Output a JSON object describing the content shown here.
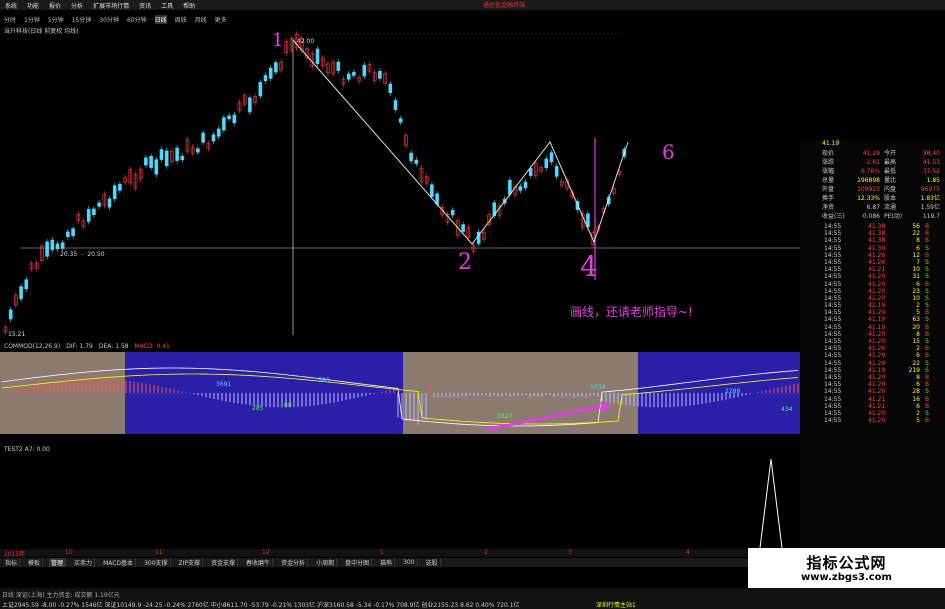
{
  "menubar": {
    "items": [
      "系统",
      "功能",
      "报价",
      "分析",
      "扩展市场行情",
      "资讯",
      "工具",
      "帮助"
    ],
    "title": "通达信金融终端"
  },
  "periodbar": {
    "items": [
      "分时",
      "1分钟",
      "5分钟",
      "15分钟",
      "30分钟",
      "60分钟",
      "日线",
      "周线",
      "月线",
      "更多"
    ],
    "active_index": 6
  },
  "stock": {
    "name": "当升科技(日线 前复权 均线)",
    "price_high": "42.00",
    "price_mid": "20.35",
    "price_mid2": "20.50",
    "price_low": "15.21"
  },
  "annotations": {
    "n1": "1",
    "n2": "2",
    "n4": "4",
    "n6": "6",
    "note": "画线，还请老师指导~!"
  },
  "macd": {
    "title": "COMMOD(12,26,9)",
    "dif": "DIF: 1.79",
    "dea": "DEA: 1.58",
    "macd": "MACD: 0.41",
    "labels": [
      "3691",
      "583",
      "285",
      "88",
      "3820",
      "1034",
      "2288",
      "434"
    ]
  },
  "test": {
    "title": "TEST2 A7: 0.00"
  },
  "right_panel": {
    "code_price": "41.19",
    "rows": [
      {
        "k": "现价",
        "v": "41.29",
        "k2": "今开",
        "v2": "38.40",
        "c": "#f44"
      },
      {
        "k": "涨跌",
        "v": "2.61",
        "k2": "最高",
        "v2": "41.53",
        "c": "#f44"
      },
      {
        "k": "涨幅",
        "v": "6.76%",
        "k2": "最低",
        "v2": "37.52",
        "c": "#f44"
      },
      {
        "k": "总量",
        "v": "196898",
        "k2": "量比",
        "v2": "1.85",
        "c": "#ff0"
      },
      {
        "k": "外盘",
        "v": "109923",
        "k2": "内盘",
        "v2": "86975",
        "c": "#f44"
      },
      {
        "k": "换手",
        "v": "12.33%",
        "k2": "股本",
        "v2": "1.83亿",
        "c": "#ff0"
      },
      {
        "k": "净资",
        "v": "6.87",
        "k2": "流通",
        "v2": "1.59亿",
        "c": "#ccc"
      },
      {
        "k": "收益(三)",
        "v": "0.086",
        "k2": "PE(动)",
        "v2": "119.7",
        "c": "#ccc"
      }
    ],
    "ticks": [
      {
        "t": "14:55",
        "p": "41.38",
        "v": "56",
        "s": "B"
      },
      {
        "t": "14:55",
        "p": "41.38",
        "v": "22",
        "s": "B"
      },
      {
        "t": "14:55",
        "p": "41.38",
        "v": "8",
        "s": "B"
      },
      {
        "t": "14:55",
        "p": "41.30",
        "v": "6",
        "s": "S"
      },
      {
        "t": "14:55",
        "p": "41.26",
        "v": "12",
        "s": "B"
      },
      {
        "t": "14:55",
        "p": "41.26",
        "v": "7",
        "s": "S"
      },
      {
        "t": "14:55",
        "p": "41.21",
        "v": "10",
        "s": "S"
      },
      {
        "t": "14:55",
        "p": "41.20",
        "v": "31",
        "s": "S"
      },
      {
        "t": "14:55",
        "p": "41.20",
        "v": "6",
        "s": "B"
      },
      {
        "t": "14:55",
        "p": "41.20",
        "v": "23",
        "s": "S"
      },
      {
        "t": "14:55",
        "p": "41.20",
        "v": "10",
        "s": "S"
      },
      {
        "t": "14:55",
        "p": "41.19",
        "v": "2",
        "s": "S"
      },
      {
        "t": "14:55",
        "p": "41.20",
        "v": "5",
        "s": "B"
      },
      {
        "t": "14:55",
        "p": "41.19",
        "v": "63",
        "s": "S"
      },
      {
        "t": "14:55",
        "p": "41.19",
        "v": "20",
        "s": "B"
      },
      {
        "t": "14:55",
        "p": "41.20",
        "v": "8",
        "s": "B"
      },
      {
        "t": "14:55",
        "p": "41.20",
        "v": "15",
        "s": "S"
      },
      {
        "t": "14:55",
        "p": "41.26",
        "v": "2",
        "s": "B"
      },
      {
        "t": "14:55",
        "p": "41.29",
        "v": "6",
        "s": "B"
      },
      {
        "t": "14:55",
        "p": "41.29",
        "v": "22",
        "s": "S"
      },
      {
        "t": "14:55",
        "p": "41.19",
        "v": "219",
        "s": "S"
      },
      {
        "t": "14:55",
        "p": "41.20",
        "v": "8",
        "s": "B"
      },
      {
        "t": "14:55",
        "p": "41.20",
        "v": "6",
        "s": "B"
      },
      {
        "t": "14:55",
        "p": "41.20",
        "v": "28",
        "s": "S"
      },
      {
        "t": "14:55",
        "p": "41.21",
        "v": "16",
        "s": "B"
      },
      {
        "t": "14:55",
        "p": "41.21",
        "v": "6",
        "s": "B"
      },
      {
        "t": "14:55",
        "p": "41.20",
        "v": "2",
        "s": "S"
      },
      {
        "t": "14:55",
        "p": "41.20",
        "v": "5",
        "s": "B"
      }
    ]
  },
  "date_bar": {
    "items": [
      "2015年",
      "10",
      "11",
      "12",
      "1",
      "2",
      "3",
      "4"
    ]
  },
  "tab_bar": {
    "items": [
      "指标",
      "模板",
      "管理",
      "买卖力",
      "MACD基本",
      "300支撑",
      "ZIP支撑",
      "资金支撑",
      "春收磨牛",
      "资金分析",
      "小周期",
      "盘中分图",
      "猫熊",
      "300",
      "选股"
    ],
    "active_index": 2
  },
  "ticker": {
    "line1": "上证2945.59  -8.00  -0.27%  1546亿   深证10149.9  -24.25  -0.24%  2760亿   中小8611.70  -53.79  -0.21%  1303亿   沪深3160.58  -5.34  -0.17%  708.9亿   创业2155.23  8.62  0.40%  720.1亿",
    "line2": "日线 深证(上海) 主力资金: 成交额 1.19亿元",
    "status": "深圳行情主站1"
  },
  "watermark": {
    "title": "指标公式网",
    "url": "www.zbgs3.com"
  },
  "colors": {
    "up": "#ff3b3b",
    "down": "#4fd8ff",
    "magenta": "#e040e0",
    "panel_bg": "#2a1fa8",
    "macd_tan": "#8a7a70"
  }
}
